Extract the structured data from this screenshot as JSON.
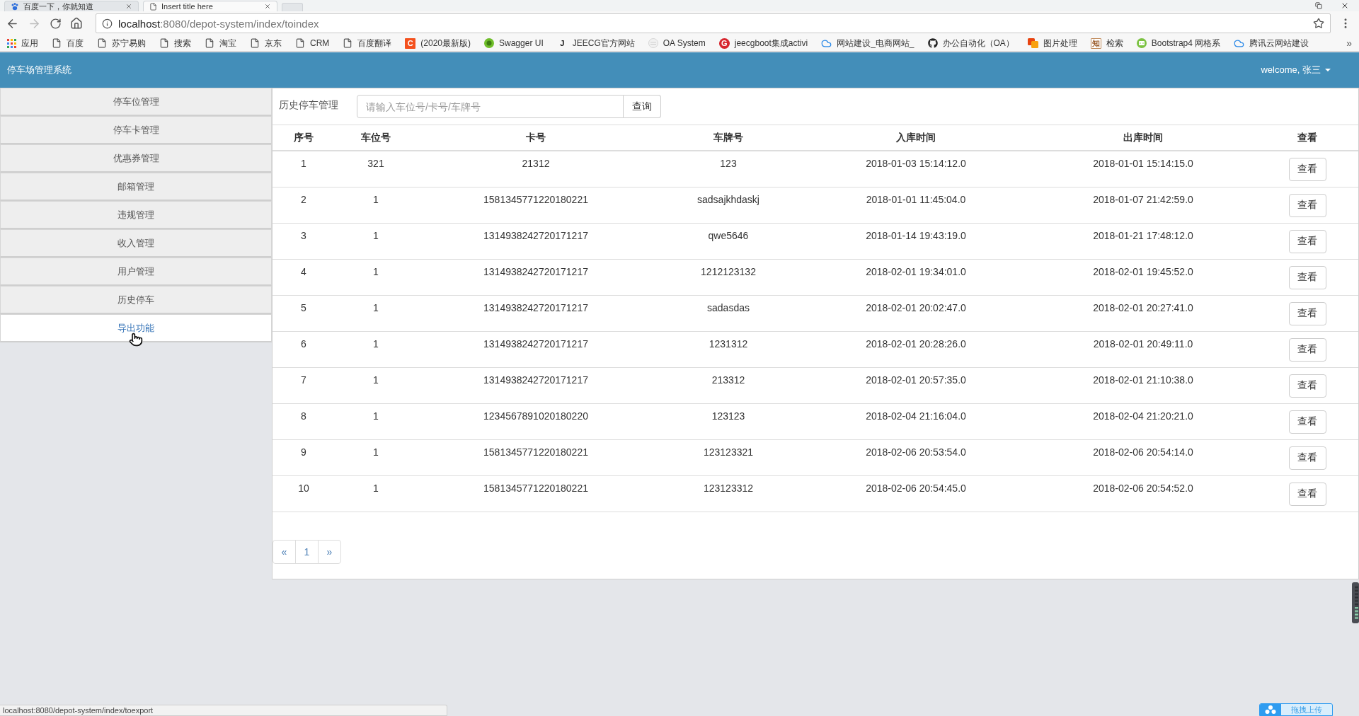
{
  "browser": {
    "tabs": [
      {
        "title": "百度一下，你就知道",
        "kind": "paw",
        "selected": false
      },
      {
        "title": "Insert title here",
        "kind": "page",
        "selected": true
      }
    ],
    "address": {
      "host": "localhost",
      "path": ":8080/depot-system/index/toindex"
    },
    "bookmarks": [
      {
        "label": "应用",
        "kind": "apps"
      },
      {
        "label": "百度",
        "kind": "page"
      },
      {
        "label": "苏宁易购",
        "kind": "page"
      },
      {
        "label": "搜索",
        "kind": "page"
      },
      {
        "label": "淘宝",
        "kind": "page"
      },
      {
        "label": "京东",
        "kind": "page"
      },
      {
        "label": "CRM",
        "kind": "page"
      },
      {
        "label": "百度翻译",
        "kind": "page"
      },
      {
        "label": "(2020最新版)",
        "kind": "orange-tile",
        "glyph": "C"
      },
      {
        "label": "Swagger UI",
        "kind": "green-disc"
      },
      {
        "label": "JEECG官方网站",
        "kind": "letter",
        "glyph": "J"
      },
      {
        "label": "OA System",
        "kind": "pale-disc"
      },
      {
        "label": "jeecgboot集成activi",
        "kind": "red-disc",
        "glyph": "G"
      },
      {
        "label": "网站建设_电商网站_",
        "kind": "cloud"
      },
      {
        "label": "办公自动化（OA）",
        "kind": "octocat"
      },
      {
        "label": "图片处理",
        "kind": "stacked-squares"
      },
      {
        "label": "检索",
        "kind": "framed-tile",
        "glyph": "知"
      },
      {
        "label": "Bootstrap4 网格系",
        "kind": "code-disc"
      },
      {
        "label": "腾讯云网站建设",
        "kind": "cloud"
      }
    ],
    "overflow": "»"
  },
  "header": {
    "title": "停车场管理系统",
    "user": "welcome, 张三"
  },
  "sidebar": {
    "items": [
      {
        "label": "停车位管理",
        "selected": false
      },
      {
        "label": "停车卡管理",
        "selected": false
      },
      {
        "label": "优惠券管理",
        "selected": false
      },
      {
        "label": "邮箱管理",
        "selected": false
      },
      {
        "label": "违规管理",
        "selected": false
      },
      {
        "label": "收入管理",
        "selected": false
      },
      {
        "label": "用户管理",
        "selected": false
      },
      {
        "label": "历史停车",
        "selected": false
      },
      {
        "label": "导出功能",
        "selected": true
      }
    ]
  },
  "toolbar": {
    "label": "历史停车管理",
    "search": {
      "placeholder": "请输入车位号/卡号/车牌号"
    },
    "button": "查询"
  },
  "table": {
    "columns": [
      "序号",
      "车位号",
      "卡号",
      "车牌号",
      "入库时间",
      "出库时间",
      "查看"
    ],
    "rows": [
      {
        "cells": [
          "1",
          "321",
          "21312",
          "123",
          "2018-01-03 15:14:12.0",
          "2018-01-01 15:14:15.0"
        ],
        "action": "查看"
      },
      {
        "cells": [
          "2",
          "1",
          "1581345771220180221",
          "sadsajkhdaskj",
          "2018-01-01 11:45:04.0",
          "2018-01-07 21:42:59.0"
        ],
        "action": "查看"
      },
      {
        "cells": [
          "3",
          "1",
          "1314938242720171217",
          "qwe5646",
          "2018-01-14 19:43:19.0",
          "2018-01-21 17:48:12.0"
        ],
        "action": "查看"
      },
      {
        "cells": [
          "4",
          "1",
          "1314938242720171217",
          "1212123132",
          "2018-02-01 19:34:01.0",
          "2018-02-01 19:45:52.0"
        ],
        "action": "查看"
      },
      {
        "cells": [
          "5",
          "1",
          "1314938242720171217",
          "sadasdas",
          "2018-02-01 20:02:47.0",
          "2018-02-01 20:27:41.0"
        ],
        "action": "查看"
      },
      {
        "cells": [
          "6",
          "1",
          "1314938242720171217",
          "1231312",
          "2018-02-01 20:28:26.0",
          "2018-02-01 20:49:11.0"
        ],
        "action": "查看"
      },
      {
        "cells": [
          "7",
          "1",
          "1314938242720171217",
          "213312",
          "2018-02-01 20:57:35.0",
          "2018-02-01 21:10:38.0"
        ],
        "action": "查看"
      },
      {
        "cells": [
          "8",
          "1",
          "1234567891020180220",
          "123123",
          "2018-02-04 21:16:04.0",
          "2018-02-04 21:20:21.0"
        ],
        "action": "查看"
      },
      {
        "cells": [
          "9",
          "1",
          "1581345771220180221",
          "123123321",
          "2018-02-06 20:53:54.0",
          "2018-02-06 20:54:14.0"
        ],
        "action": "查看"
      },
      {
        "cells": [
          "10",
          "1",
          "1581345771220180221",
          "123123312",
          "2018-02-06 20:54:45.0",
          "2018-02-06 20:54:52.0"
        ],
        "action": "查看"
      }
    ]
  },
  "pagination": [
    {
      "label": "«",
      "kind": "prev"
    },
    {
      "label": "1",
      "kind": "page"
    },
    {
      "label": "»",
      "kind": "next"
    }
  ],
  "status_bar": "localhost:8080/depot-system/index/toexport",
  "upload_widget": {
    "label": "拖拽上传"
  }
}
